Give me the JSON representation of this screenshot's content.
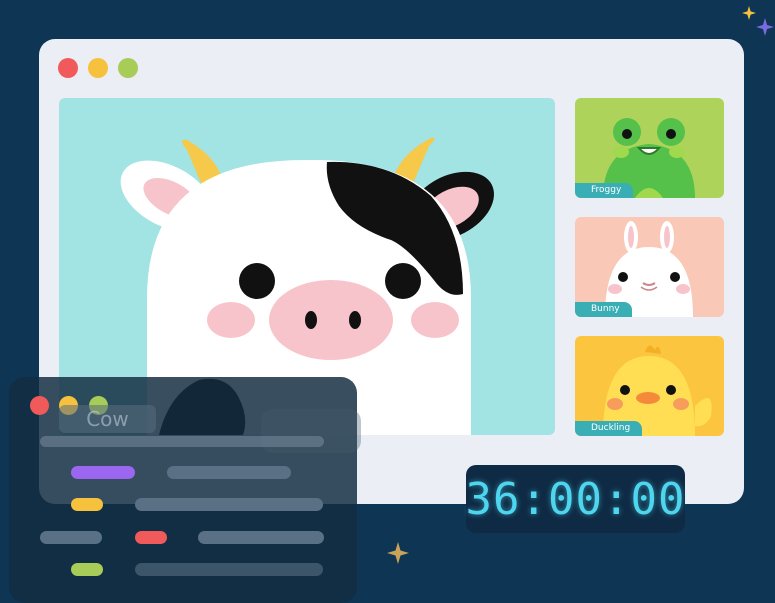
{
  "colors": {
    "background": "#0f3555",
    "window": "#eceef6",
    "traffic_red": "#f15a5b",
    "traffic_yellow": "#f6c13c",
    "traffic_green": "#a7cc58",
    "timer_text": "#4ed6ee",
    "label_bg": "#3aaeb5",
    "bar_purple": "#9b66f0",
    "bar_yellow": "#f6c13c",
    "bar_red": "#f15a5b",
    "bar_green": "#a7cc58"
  },
  "main_video": {
    "participant": "Cow"
  },
  "thumbnails": [
    {
      "label": "Froggy",
      "bg": "#aed35a"
    },
    {
      "label": "Bunny",
      "bg": "#f9c8b6"
    },
    {
      "label": "Duckling",
      "bg": "#fbc53f"
    }
  ],
  "timer": {
    "text": "36:00:00"
  },
  "icons": [
    "window-controls",
    "sparkle-icon",
    "cow-avatar",
    "frog-avatar",
    "bunny-avatar",
    "duckling-avatar"
  ]
}
